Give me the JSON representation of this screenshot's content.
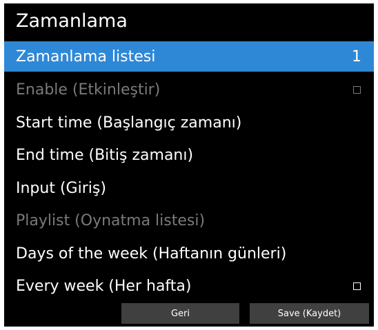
{
  "header": {
    "title": "Zamanlama"
  },
  "menu": {
    "items": [
      {
        "label": "Zamanlama listesi",
        "value": "1",
        "state": "selected"
      },
      {
        "label": "Enable (Etkinleştir)",
        "state": "disabled",
        "checkbox": "unchecked"
      },
      {
        "label": "Start time (Başlangıç zamanı)",
        "state": "normal"
      },
      {
        "label": "End time (Bitiş zamanı)",
        "state": "normal"
      },
      {
        "label": "Input (Giriş)",
        "state": "normal"
      },
      {
        "label": "Playlist (Oynatma listesi)",
        "state": "disabled"
      },
      {
        "label": "Days of the week (Haftanın günleri)",
        "state": "normal"
      },
      {
        "label": "Every week (Her hafta)",
        "state": "normal",
        "checkbox": "unchecked"
      }
    ]
  },
  "footer": {
    "back_label": "Geri",
    "save_label": "Save (Kaydet)"
  },
  "colors": {
    "background": "#000000",
    "selection": "#2f88d6",
    "text": "#ffffff",
    "disabled_text": "#7a7a7a",
    "button": "#404040"
  }
}
